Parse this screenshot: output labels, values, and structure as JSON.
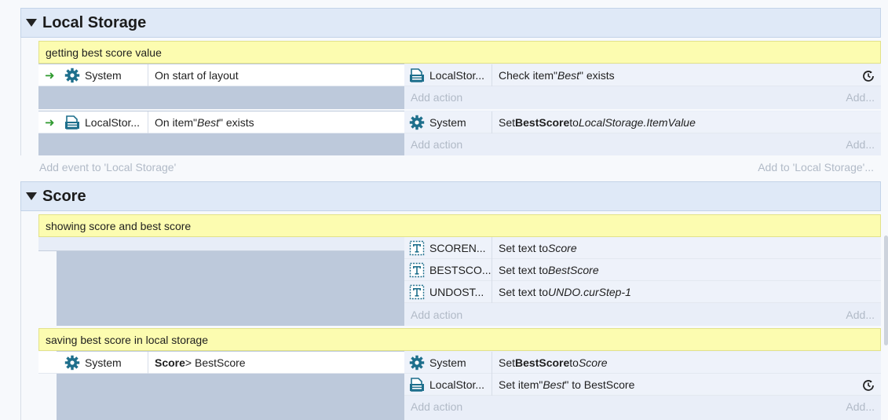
{
  "groups": [
    {
      "title": "Local Storage",
      "add_event": "Add event to 'Local Storage'",
      "add_to": "Add to 'Local Storage'..."
    },
    {
      "title": "Score"
    }
  ],
  "events": [
    {
      "comment": "getting best score value",
      "condition": {
        "object": "System",
        "text": "On start of layout"
      },
      "actions": [
        {
          "object": "LocalStor...",
          "text_parts": [
            [
              "Check item ",
              ""
            ],
            [
              "\"",
              ""
            ],
            [
              "Best",
              "i"
            ],
            [
              "\" exists",
              ""
            ]
          ]
        }
      ]
    },
    {
      "condition": {
        "object": "LocalStor...",
        "text_parts": [
          [
            "On item ",
            ""
          ],
          [
            "\"",
            ""
          ],
          [
            "Best",
            "i"
          ],
          [
            "\" exists",
            ""
          ]
        ]
      },
      "actions": [
        {
          "object": "System",
          "text_parts": [
            [
              "Set ",
              ""
            ],
            [
              "BestScore",
              "b"
            ],
            [
              " to ",
              ""
            ],
            [
              "LocalStorage.ItemValue",
              "i"
            ]
          ]
        }
      ]
    },
    {
      "comment": "showing score and best score",
      "actions": [
        {
          "object": "SCOREN...",
          "text_parts": [
            [
              "Set text to ",
              ""
            ],
            [
              "Score",
              "i"
            ]
          ]
        },
        {
          "object": "BESTSCO...",
          "text_parts": [
            [
              "Set text to ",
              ""
            ],
            [
              "BestScore",
              "i"
            ]
          ]
        },
        {
          "object": "UNDOST...",
          "text_parts": [
            [
              "Set text to ",
              ""
            ],
            [
              "UNDO.curStep-1",
              "i"
            ]
          ]
        }
      ]
    },
    {
      "comment": "saving best score in local storage",
      "condition": {
        "object": "System",
        "text_parts": [
          [
            "Score",
            "b"
          ],
          [
            " > BestScore",
            ""
          ]
        ]
      },
      "actions": [
        {
          "object": "System",
          "text_parts": [
            [
              "Set ",
              ""
            ],
            [
              "BestScore",
              "b"
            ],
            [
              " to ",
              ""
            ],
            [
              "Score",
              "i"
            ]
          ]
        },
        {
          "object": "LocalStor...",
          "text_parts": [
            [
              "Set item ",
              ""
            ],
            [
              "\"",
              ""
            ],
            [
              "Best",
              "i"
            ],
            [
              "\" to BestScore",
              ""
            ]
          ]
        }
      ]
    }
  ],
  "labels": {
    "add_action": "Add action",
    "add_short": "Add..."
  },
  "colors": {
    "group_header": "#dfe9f7",
    "comment": "#fcfcb0",
    "accent_icon": "#1e6f8c",
    "trigger_arrow": "#2f9a2f"
  },
  "icons": {
    "system": "gear-icon",
    "local_storage": "local-storage-icon",
    "text": "text-object-icon",
    "trigger": "trigger-arrow-icon",
    "async": "async-clock-icon"
  }
}
